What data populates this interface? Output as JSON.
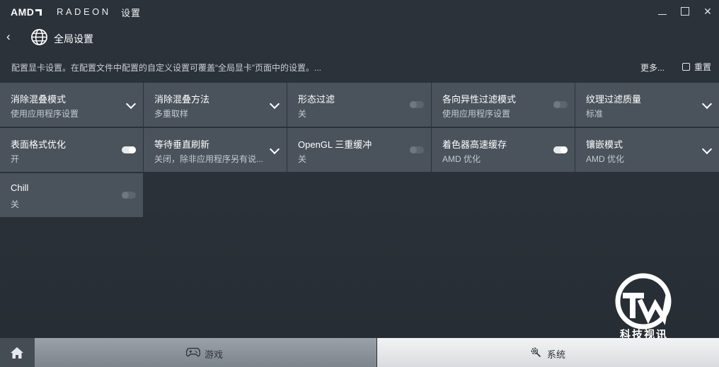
{
  "titlebar": {
    "brand": "AMD",
    "product": "RADEON",
    "settings": "设置",
    "close_glyph": "✕"
  },
  "header": {
    "back_glyph": "‹",
    "title": "全局设置"
  },
  "description": "配置显卡设置。在配置文件中配置的自定义设置可覆盖“全局显卡”页面中的设置。...",
  "actions": {
    "more": "更多...",
    "reset": "重置"
  },
  "settings": [
    {
      "label": "消除混叠模式",
      "value": "使用应用程序设置",
      "control": "dropdown"
    },
    {
      "label": "消除混叠方法",
      "value": "多重取样",
      "control": "dropdown"
    },
    {
      "label": "形态过滤",
      "value": "关",
      "control": "toggle",
      "state": "off"
    },
    {
      "label": "各向异性过滤模式",
      "value": "使用应用程序设置",
      "control": "toggle",
      "state": "off"
    },
    {
      "label": "纹理过滤质量",
      "value": "标准",
      "control": "dropdown"
    },
    {
      "label": "表面格式优化",
      "value": "开",
      "control": "toggle",
      "state": "on"
    },
    {
      "label": "等待垂直刷新",
      "value": "关闭，除非应用程序另有说...",
      "control": "dropdown"
    },
    {
      "label": "OpenGL 三重缓冲",
      "value": "关",
      "control": "toggle",
      "state": "off"
    },
    {
      "label": "着色器高速缓存",
      "value": "AMD 优化",
      "control": "toggle",
      "state": "on"
    },
    {
      "label": "镶嵌模式",
      "value": "AMD 优化",
      "control": "dropdown"
    },
    {
      "label": "Chill",
      "value": "关",
      "control": "toggle",
      "state": "off"
    }
  ],
  "watermark": "科技视讯",
  "bottombar": {
    "games": "游戏",
    "system": "系统"
  },
  "colors": {
    "background": "#2a3138",
    "tile": "#4a535c",
    "system_tab": "#e6e8ea",
    "games_tab": "#8c939a"
  },
  "icons": [
    "amd-logo-icon",
    "minimize-icon",
    "maximize-icon",
    "close-icon",
    "back-icon",
    "globe-icon",
    "reset-icon",
    "chevron-down-icon",
    "toggle-icon",
    "home-icon",
    "gamepad-icon",
    "gear-wrench-icon"
  ]
}
